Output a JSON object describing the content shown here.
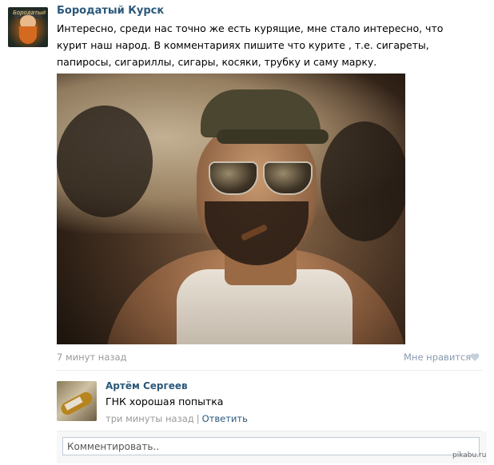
{
  "post": {
    "author": "Бородатый Курск",
    "text": "Интересно, среди нас точно же есть курящие, мне стало интересно, что курит наш народ. В комментариях пишите что курите , т.е. сигареты, папиросы, сигариллы, сигары, косяки, трубку и саму марку.",
    "time": "7 минут назад",
    "like_label": "Мне нравится",
    "avatar_text": "Бородатый"
  },
  "comment": {
    "author": "Артём Сергеев",
    "text": "ГНК хорошая попытка",
    "time": "три минуты назад",
    "separator": "|",
    "reply_label": "Ответить"
  },
  "comment_input": {
    "placeholder": "Комментировать.."
  },
  "watermark": "pikabu.ru",
  "colors": {
    "link": "#2b587a",
    "meta": "#999999",
    "like": "#8a9bb0",
    "input_border": "#c0cad5"
  },
  "icons": {
    "like": "heart-icon"
  }
}
